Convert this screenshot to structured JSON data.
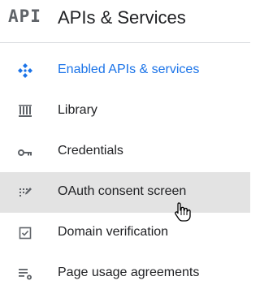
{
  "header": {
    "logo_text": "API",
    "title": "APIs & Services"
  },
  "sidebar": {
    "items": [
      {
        "label": "Enabled APIs & services",
        "icon": "apis-diamond-icon",
        "active": true
      },
      {
        "label": "Library",
        "icon": "library-icon"
      },
      {
        "label": "Credentials",
        "icon": "key-icon"
      },
      {
        "label": "OAuth consent screen",
        "icon": "consent-screen-icon",
        "hover": true
      },
      {
        "label": "Domain verification",
        "icon": "checkbox-icon"
      },
      {
        "label": "Page usage agreements",
        "icon": "settings-list-icon"
      }
    ]
  },
  "colors": {
    "accent": "#1a73e8",
    "icon_gray": "#5f6368",
    "hover_bg": "#e3e3e3",
    "divider": "#dadce0"
  },
  "cursor": "hand-pointer-icon"
}
